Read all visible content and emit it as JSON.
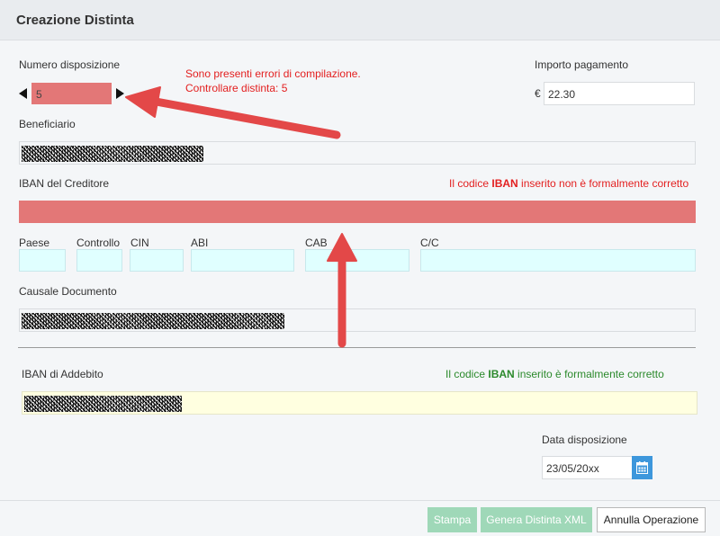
{
  "header": {
    "title": "Creazione Distinta"
  },
  "numero": {
    "label": "Numero disposizione",
    "value": "5"
  },
  "errors": {
    "line1": "Sono presenti errori di compilazione.",
    "line2": "Controllare distinta: 5"
  },
  "importo": {
    "label": "Importo pagamento",
    "currency": "€",
    "value": "22.30"
  },
  "beneficiario": {
    "label": "Beneficiario"
  },
  "iban_creditore": {
    "label": "IBAN del Creditore",
    "msg_prefix": "Il codice ",
    "msg_strong": "IBAN",
    "msg_suffix": " inserito non è formalmente corretto"
  },
  "iban_parts": {
    "paese": "Paese",
    "controllo": "Controllo",
    "cin": "CIN",
    "abi": "ABI",
    "cab": "CAB",
    "cc": "C/C"
  },
  "causale": {
    "label": "Causale Documento"
  },
  "iban_addebito": {
    "label": "IBAN di Addebito",
    "msg_prefix": "Il codice ",
    "msg_strong": "IBAN",
    "msg_suffix": " inserito è formalmente corretto"
  },
  "data": {
    "label": "Data disposizione",
    "value": "23/05/20xx",
    "icon": "calendar-icon"
  },
  "footer": {
    "stampa": "Stampa",
    "genera": "Genera Distinta XML",
    "annulla": "Annulla Operazione"
  },
  "colors": {
    "error_bg": "#e37777",
    "error_text": "#e32020",
    "ok_text": "#2c8a2c",
    "accent": "#3d97dc",
    "arrow": "#e34848"
  }
}
